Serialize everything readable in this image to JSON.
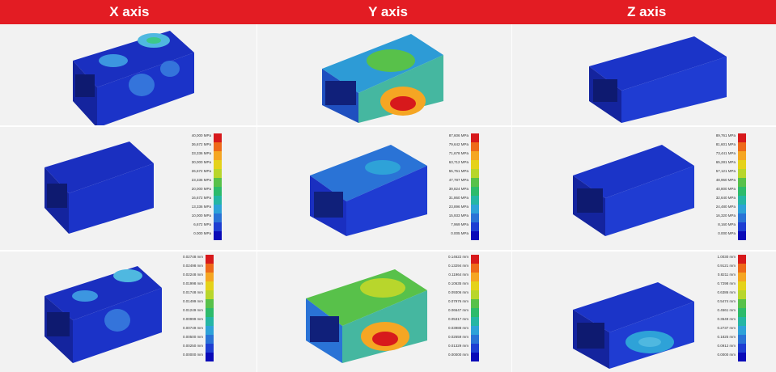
{
  "header": {
    "col_x": "X axis",
    "col_y": "Y axis",
    "col_z": "Z axis"
  },
  "colors": {
    "header_bg": "#e31c23",
    "scale": [
      "#d7191c",
      "#ee6a1a",
      "#f5a623",
      "#e5d21a",
      "#b8d62c",
      "#58c14a",
      "#2dbb6b",
      "#25b6a4",
      "#2ea2d8",
      "#2a73d6",
      "#1e3ed2",
      "#0a0ab8"
    ]
  },
  "legends": {
    "row2_x": [
      "40,000 MPa",
      "36,672 MPa",
      "33,336 MPa",
      "30,000 MPa",
      "26,672 MPa",
      "23,336 MPa",
      "20,000 MPa",
      "16,672 MPa",
      "13,336 MPa",
      "10,000 MPa",
      "6,672 MPa",
      "0.000 MPa"
    ],
    "row2_y": [
      "87,606 MPa",
      "79,642 MPa",
      "71,678 MPa",
      "63,712 MPa",
      "55,751 MPa",
      "47,787 MPa",
      "39,824 MPa",
      "31,860 MPa",
      "23,896 MPa",
      "15,933 MPa",
      "7,969 MPa",
      "0.005 MPa"
    ],
    "row2_z": [
      "89,761 MPa",
      "81,601 MPa",
      "73,441 MPa",
      "65,281 MPa",
      "57,121 MPa",
      "48,960 MPa",
      "40,800 MPa",
      "32,640 MPa",
      "24,480 MPa",
      "16,320 MPa",
      "8,160 MPa",
      "0.000 MPa"
    ],
    "row3_x": [
      "0.02748 mm",
      "0.02498 mm",
      "0.02248 mm",
      "0.01998 mm",
      "0.01748 mm",
      "0.01499 mm",
      "0.01249 mm",
      "0.00999 mm",
      "0.00749 mm",
      "0.00500 mm",
      "0.00250 mm",
      "0.00000 mm"
    ],
    "row3_y": [
      "0.14622 mm",
      "0.13294 mm",
      "0.11964 mm",
      "0.10635 mm",
      "0.09306 mm",
      "0.07976 mm",
      "0.06647 mm",
      "0.05317 mm",
      "0.03988 mm",
      "0.02659 mm",
      "0.01329 mm",
      "0.00000 mm"
    ],
    "row3_z": [
      "1.0030 mm",
      "0.9121 mm",
      "0.8211 mm",
      "0.7298 mm",
      "0.6386 mm",
      "0.5474 mm",
      "0.4561 mm",
      "0.3649 mm",
      "0.2737 mm",
      "0.1825 mm",
      "0.0912 mm",
      "0.0000 mm"
    ]
  }
}
